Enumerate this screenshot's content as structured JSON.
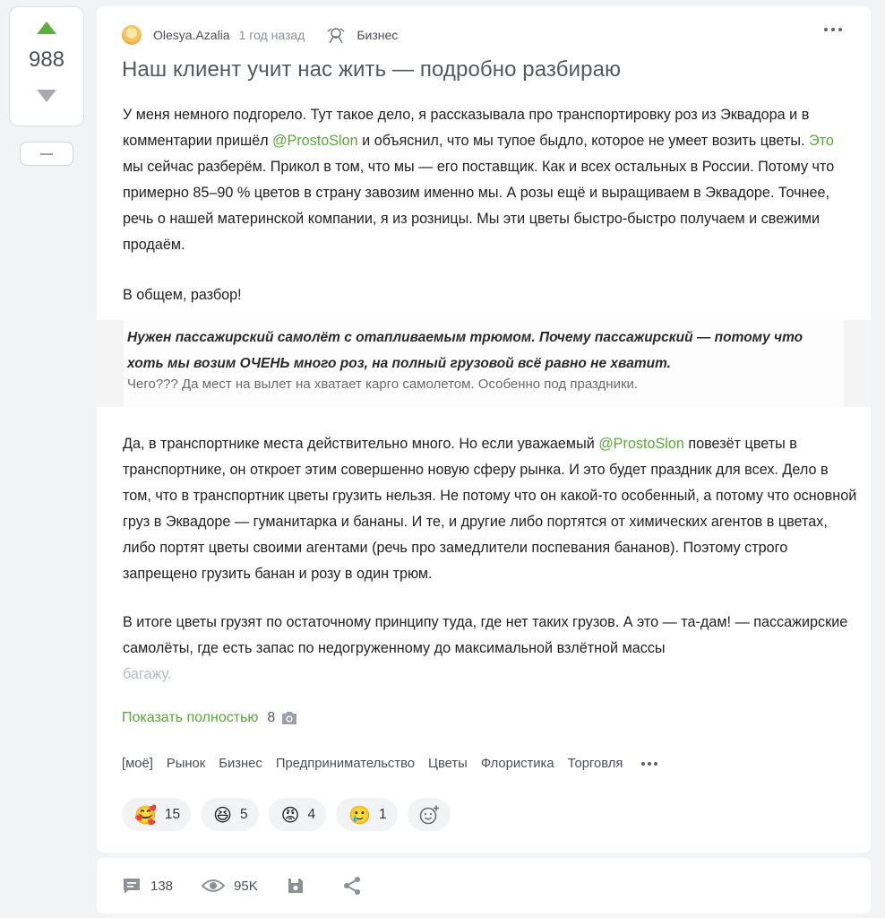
{
  "vote": {
    "count": "988"
  },
  "post": {
    "author": "Olesya.Azalia",
    "time": "1 год назад",
    "community": "Бизнес",
    "title": "Наш клиент учит нас жить — подробно разбираю",
    "p1": {
      "a": "У меня немного подгорело. Тут такое дело, я рассказывала про транспортировку роз из Эквадора и в комментарии пришёл ",
      "mention": "@ProstoSlon",
      "b": " и объяснил, что мы тупое быдло, которое не умеет возить цветы. ",
      "link": "Это",
      "c": " мы сейчас разберём. Прикол в том, что мы — его поставщик. Как и всех остальных в России. Потому что примерно 85–90 % цветов в страну завозим именно мы. А розы ещё и выращиваем в Эквадоре. Точнее, речь о нашей материнской компании, я из розницы. Мы эти цветы быстро-быстро получаем и свежими продаём."
    },
    "p2": "В общем, разбор!",
    "quote": {
      "bold": "Нужен пассажирский самолёт с отапливаемым трюмом. Почему пассажирский — потому что хоть мы возим ОЧЕНЬ много роз, на полный грузовой всё равно не хватит.",
      "plain": "Чего??? Да мест на вылет на хватает карго самолетом. Особенно под праздники."
    },
    "p3": {
      "a": "Да, в транспортнике места действительно много. Но если уважаемый ",
      "mention": "@ProstoSlon",
      "b": " повезёт цветы в транспортнике, он откроет этим совершенно новую сферу рынка. И это будет праздник для всех. Дело в том, что в транспортник цветы грузить нельзя. Не потому что он какой-то особенный, а потому что основной груз в Эквадоре — гуманитарка и бананы. И те, и другие либо портятся от химических агентов в цветах, либо портят цветы своими агентами (речь про замедлители поспевания бананов). Поэтому строго запрещено грузить банан и розу в один трюм."
    },
    "p4": {
      "a": "В итоге цветы грузят по остаточному принципу туда, где нет таких грузов. А это — та-дам! — пассажирские самолёты, где есть запас по недогруженному до максимальной взлётной массы",
      "faded": "багажу."
    },
    "show_more": "Показать полностью",
    "images_count": "8",
    "tags": [
      "[моё]",
      "Рынок",
      "Бизнес",
      "Предпринимательство",
      "Цветы",
      "Флористика",
      "Торговля"
    ],
    "reactions": [
      {
        "emoji": "🥰",
        "count": "15"
      },
      {
        "emoji": "😆",
        "count": "5"
      },
      {
        "emoji": "😡",
        "count": "4"
      },
      {
        "emoji": "🥲",
        "count": "1"
      }
    ]
  },
  "footer": {
    "comments": "138",
    "views": "95K"
  },
  "colors": {
    "accent_green": "#5aa83a",
    "upvote": "#5cb03a",
    "background": "#f2f3f5"
  }
}
